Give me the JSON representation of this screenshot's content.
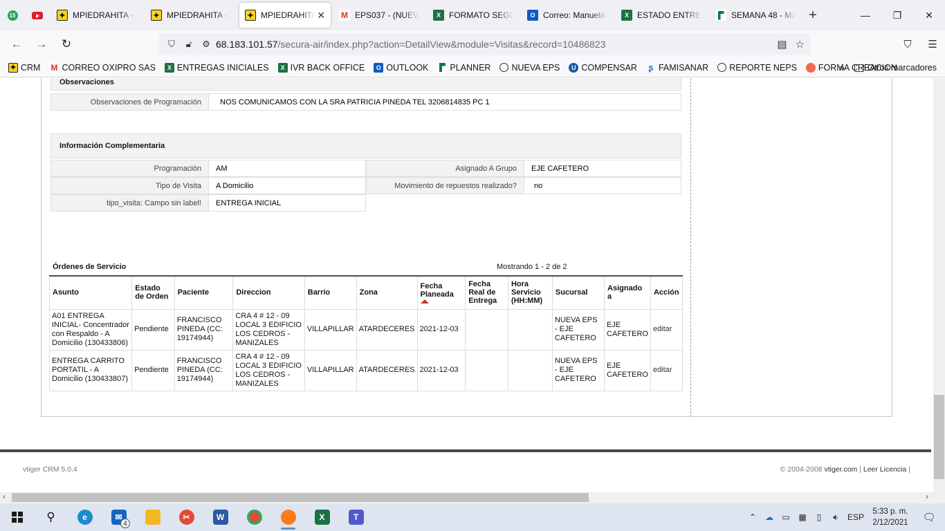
{
  "browser": {
    "pinned_badge": "15",
    "tabs": [
      {
        "label": "MPIEDRAHITA - Visitas",
        "icon": "vtiger-icon"
      },
      {
        "label": "MPIEDRAHITA - Visitas",
        "icon": "vtiger-icon"
      },
      {
        "label": "MPIEDRAHITA",
        "icon": "vtiger-icon",
        "active": true
      },
      {
        "label": "EPS037 - (NUEVA EPS)",
        "icon": "gmail-icon"
      },
      {
        "label": "FORMATO SEGUIMIENTO",
        "icon": "excel-icon"
      },
      {
        "label": "Correo: Manuela Piedrahita",
        "icon": "outlook-icon"
      },
      {
        "label": "ESTADO ENTREGAS",
        "icon": "excel-icon"
      },
      {
        "label": "SEMANA 48 - MAYO",
        "icon": "forms-icon"
      }
    ],
    "url_host": "68.183.101.57",
    "url_path": "/secura-air/index.php?action=DetailView&module=Visitas&record=10486823",
    "bookmarks": [
      {
        "label": "CRM",
        "icon": "vtiger-icon"
      },
      {
        "label": "CORREO OXIPRO SAS",
        "icon": "gmail-icon"
      },
      {
        "label": "ENTREGAS INICIALES",
        "icon": "excel-icon"
      },
      {
        "label": "IVR BACK OFFICE",
        "icon": "excel-icon"
      },
      {
        "label": "OUTLOOK",
        "icon": "outlook-icon"
      },
      {
        "label": "PLANNER",
        "icon": "planner-icon"
      },
      {
        "label": "NUEVA EPS",
        "icon": "globe-icon"
      },
      {
        "label": "COMPENSAR",
        "icon": "compensar-icon"
      },
      {
        "label": "FAMISANAR",
        "icon": "famisanar-icon"
      },
      {
        "label": "REPORTE NEPS",
        "icon": "globe-icon"
      },
      {
        "label": "FORMA CREACION",
        "icon": "location-icon"
      }
    ],
    "other_bookmarks": "Otros marcadores"
  },
  "observaciones": {
    "header": "Observaciones",
    "label": "Observaciones de Programación",
    "value": "NOS COMUNICAMOS CON LA SRA PATRICIA PINEDA TEL 3206814835 PC 1"
  },
  "info": {
    "header": "Información Complementaria",
    "programacion_label": "Programación",
    "programacion_value": "AM",
    "asignado_label": "Asignado A Grupo",
    "asignado_value": "EJE CAFETERO",
    "tipo_label": "Tipo de Visita",
    "tipo_value": "A Domicilio",
    "movimiento_label": "Movimiento de repuestos realizado?",
    "movimiento_value": "no",
    "tipo_visita_label": "tipo_visita: Campo sin label!",
    "tipo_visita_value": "ENTREGA INICIAL"
  },
  "ordenes": {
    "title": "Órdenes de Servicio",
    "count": "Mostrando 1 - 2 de 2",
    "columns": [
      "Asunto",
      "Estado de Orden",
      "Paciente",
      "Direccion",
      "Barrio",
      "Zona",
      "Fecha Planeada",
      "Fecha Real de Entrega",
      "Hora Servicio (HH:MM)",
      "Sucursal",
      "Asignado a",
      "Acción"
    ],
    "rows": [
      {
        "asunto": "A01 ENTREGA INICIAL- Concentrador con Respaldo - A Domicilio (130433806)",
        "estado": "Pendiente",
        "paciente": "FRANCISCO PINEDA (CC: 19174944)",
        "direccion": "CRA 4 # 12 - 09 LOCAL 3 EDIFICIO LOS CEDROS - MANIZALES",
        "barrio": "VILLAPILLAR",
        "zona": "ATARDECERES",
        "fecha_planeada": "2021-12-03",
        "fecha_real": "",
        "hora": "",
        "sucursal": "NUEVA EPS - EJE CAFETERO",
        "asignado": "EJE CAFETERO",
        "accion": "editar"
      },
      {
        "asunto": "ENTREGA CARRITO PORTATIL - A Domicilio (130433807)",
        "estado": "Pendiente",
        "paciente": "FRANCISCO PINEDA (CC: 19174944)",
        "direccion": "CRA 4 # 12 - 09 LOCAL 3 EDIFICIO LOS CEDROS - MANIZALES",
        "barrio": "VILLAPILLAR",
        "zona": "ATARDECERES",
        "fecha_planeada": "2021-12-03",
        "fecha_real": "",
        "hora": "",
        "sucursal": "NUEVA EPS - EJE CAFETERO",
        "asignado": "EJE CAFETERO",
        "accion": "editar"
      }
    ]
  },
  "footer": {
    "version": "vtiger CRM 5.0.4",
    "copyright": "© 2004-2008",
    "site": "vtiger.com",
    "licence": "Leer Licencia"
  },
  "taskbar": {
    "mail_badge": "4",
    "language": "ESP",
    "time": "5:33 p. m.",
    "date": "2/12/2021"
  }
}
